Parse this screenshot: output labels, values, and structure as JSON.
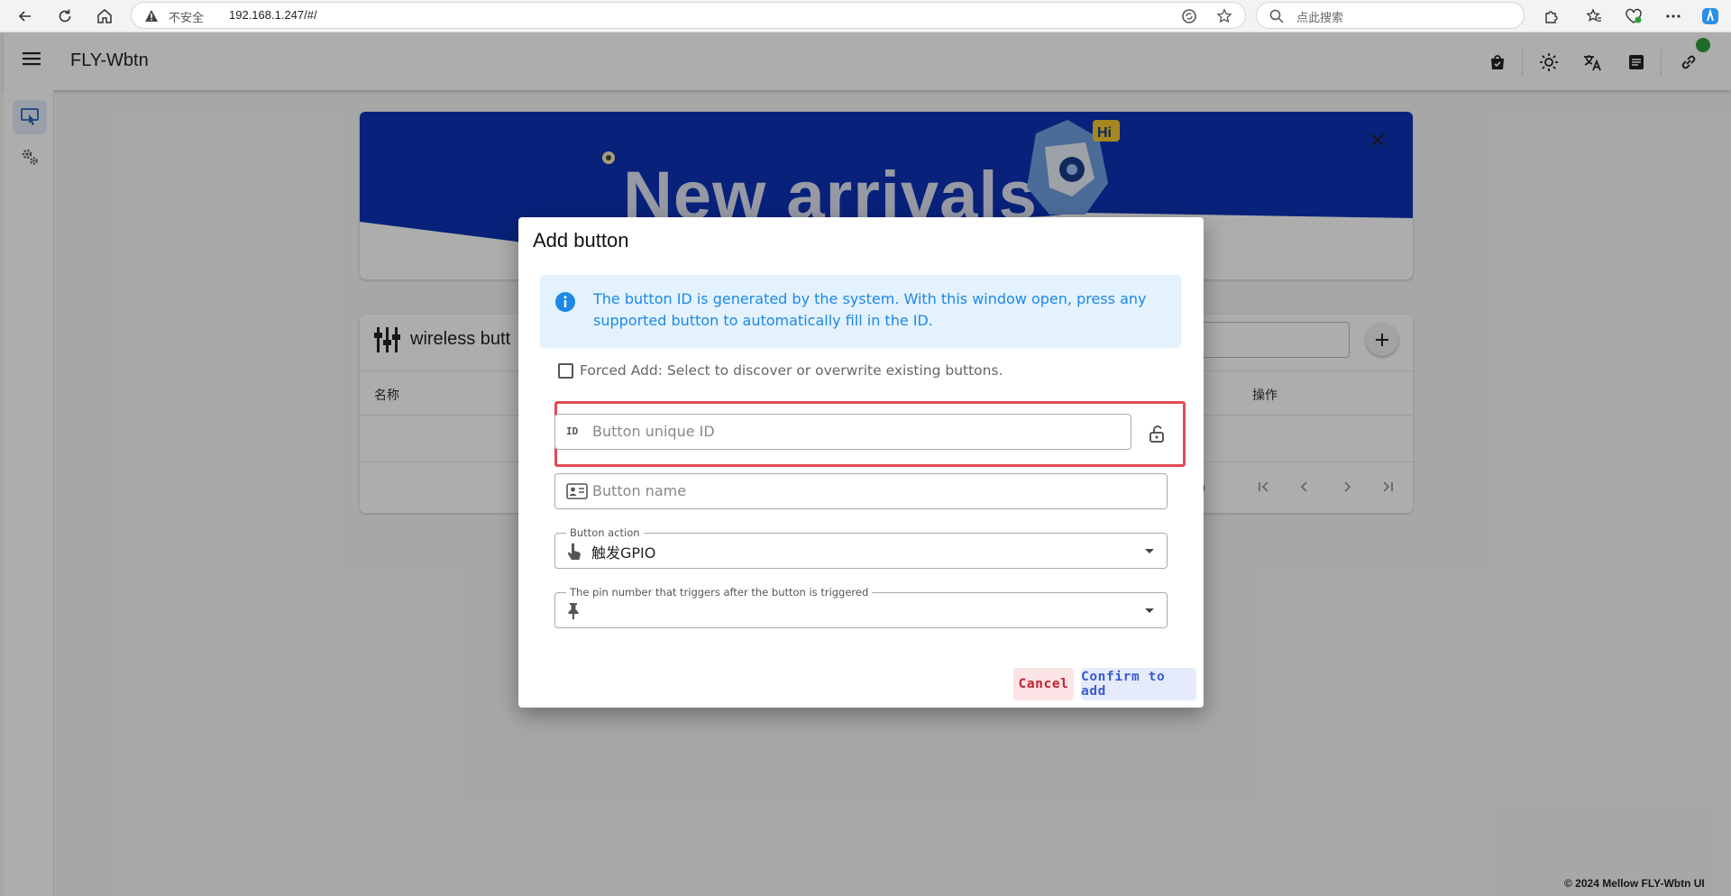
{
  "browser": {
    "insecure_label": "不安全",
    "url": "192.168.1.247/#/",
    "search_placeholder": "点此搜索"
  },
  "app": {
    "title": "FLY-Wbtn",
    "status_color": "#2e9d3a",
    "header_icons": [
      "shopping-bag-icon",
      "brightness-icon",
      "translate-icon",
      "document-icon",
      "link-icon"
    ],
    "sidebar_icons": [
      "touch-screen-icon",
      "settings-icon"
    ]
  },
  "banner": {
    "headline": "New arrivals",
    "mascot_badge": "Hi"
  },
  "card": {
    "title": "wireless butt",
    "columns": {
      "name": "名称",
      "operations": "操作"
    },
    "page_info": "f 0"
  },
  "dialog": {
    "title": "Add button",
    "info": "The button ID is generated by the system. With this window open, press any supported button to automatically fill in the ID.",
    "forced_add_label": "Forced Add: Select to discover or overwrite existing buttons.",
    "forced_add_checked": false,
    "id_field": {
      "icon_text": "ID",
      "placeholder": "Button unique ID",
      "value": ""
    },
    "name_field": {
      "placeholder": "Button name",
      "value": ""
    },
    "action_field": {
      "legend": "Button action",
      "value": "触发GPIO"
    },
    "pin_field": {
      "legend": "The pin number that triggers after the button is triggered",
      "value": ""
    },
    "cancel_label": "Cancel",
    "confirm_label": "Confirm to add"
  },
  "footer": {
    "text": "© 2024 Mellow FLY-Wbtn UI"
  }
}
